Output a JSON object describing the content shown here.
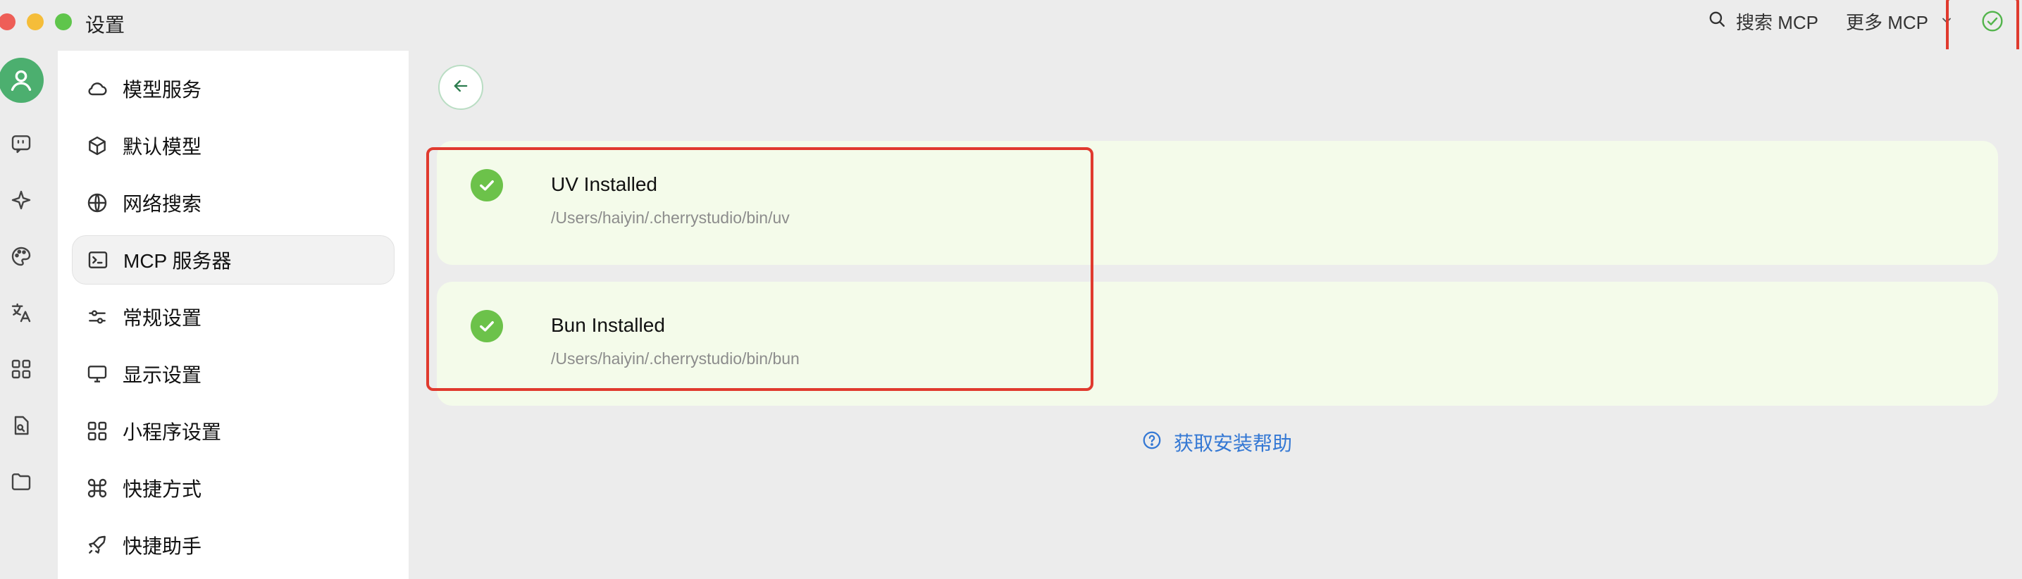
{
  "window": {
    "title": "设置"
  },
  "titlebar": {
    "search_label": "搜索 MCP",
    "more_label": "更多 MCP"
  },
  "rail": {
    "icons": [
      "user-avatar-icon",
      "chat-icon",
      "sparkle-icon",
      "palette-icon",
      "translate-icon",
      "apps-grid-icon",
      "file-search-icon",
      "folder-icon"
    ]
  },
  "menu": {
    "items": [
      {
        "label": "模型服务",
        "icon": "cloud-icon"
      },
      {
        "label": "默认模型",
        "icon": "cube-icon"
      },
      {
        "label": "网络搜索",
        "icon": "globe-icon"
      },
      {
        "label": "MCP 服务器",
        "icon": "terminal-icon",
        "active": true
      },
      {
        "label": "常规设置",
        "icon": "sliders-icon"
      },
      {
        "label": "显示设置",
        "icon": "monitor-icon"
      },
      {
        "label": "小程序设置",
        "icon": "grid-icon"
      },
      {
        "label": "快捷方式",
        "icon": "command-icon"
      },
      {
        "label": "快捷助手",
        "icon": "rocket-icon"
      }
    ]
  },
  "content": {
    "cards": [
      {
        "title": "UV Installed",
        "path": "/Users/haiyin/.cherrystudio/bin/uv"
      },
      {
        "title": "Bun Installed",
        "path": "/Users/haiyin/.cherrystudio/bin/bun"
      }
    ],
    "help_link": "获取安装帮助"
  },
  "colors": {
    "accent_green": "#6cc24a",
    "card_bg": "#f4fbea",
    "link_blue": "#3478d4",
    "highlight_red": "#e03a2e"
  }
}
